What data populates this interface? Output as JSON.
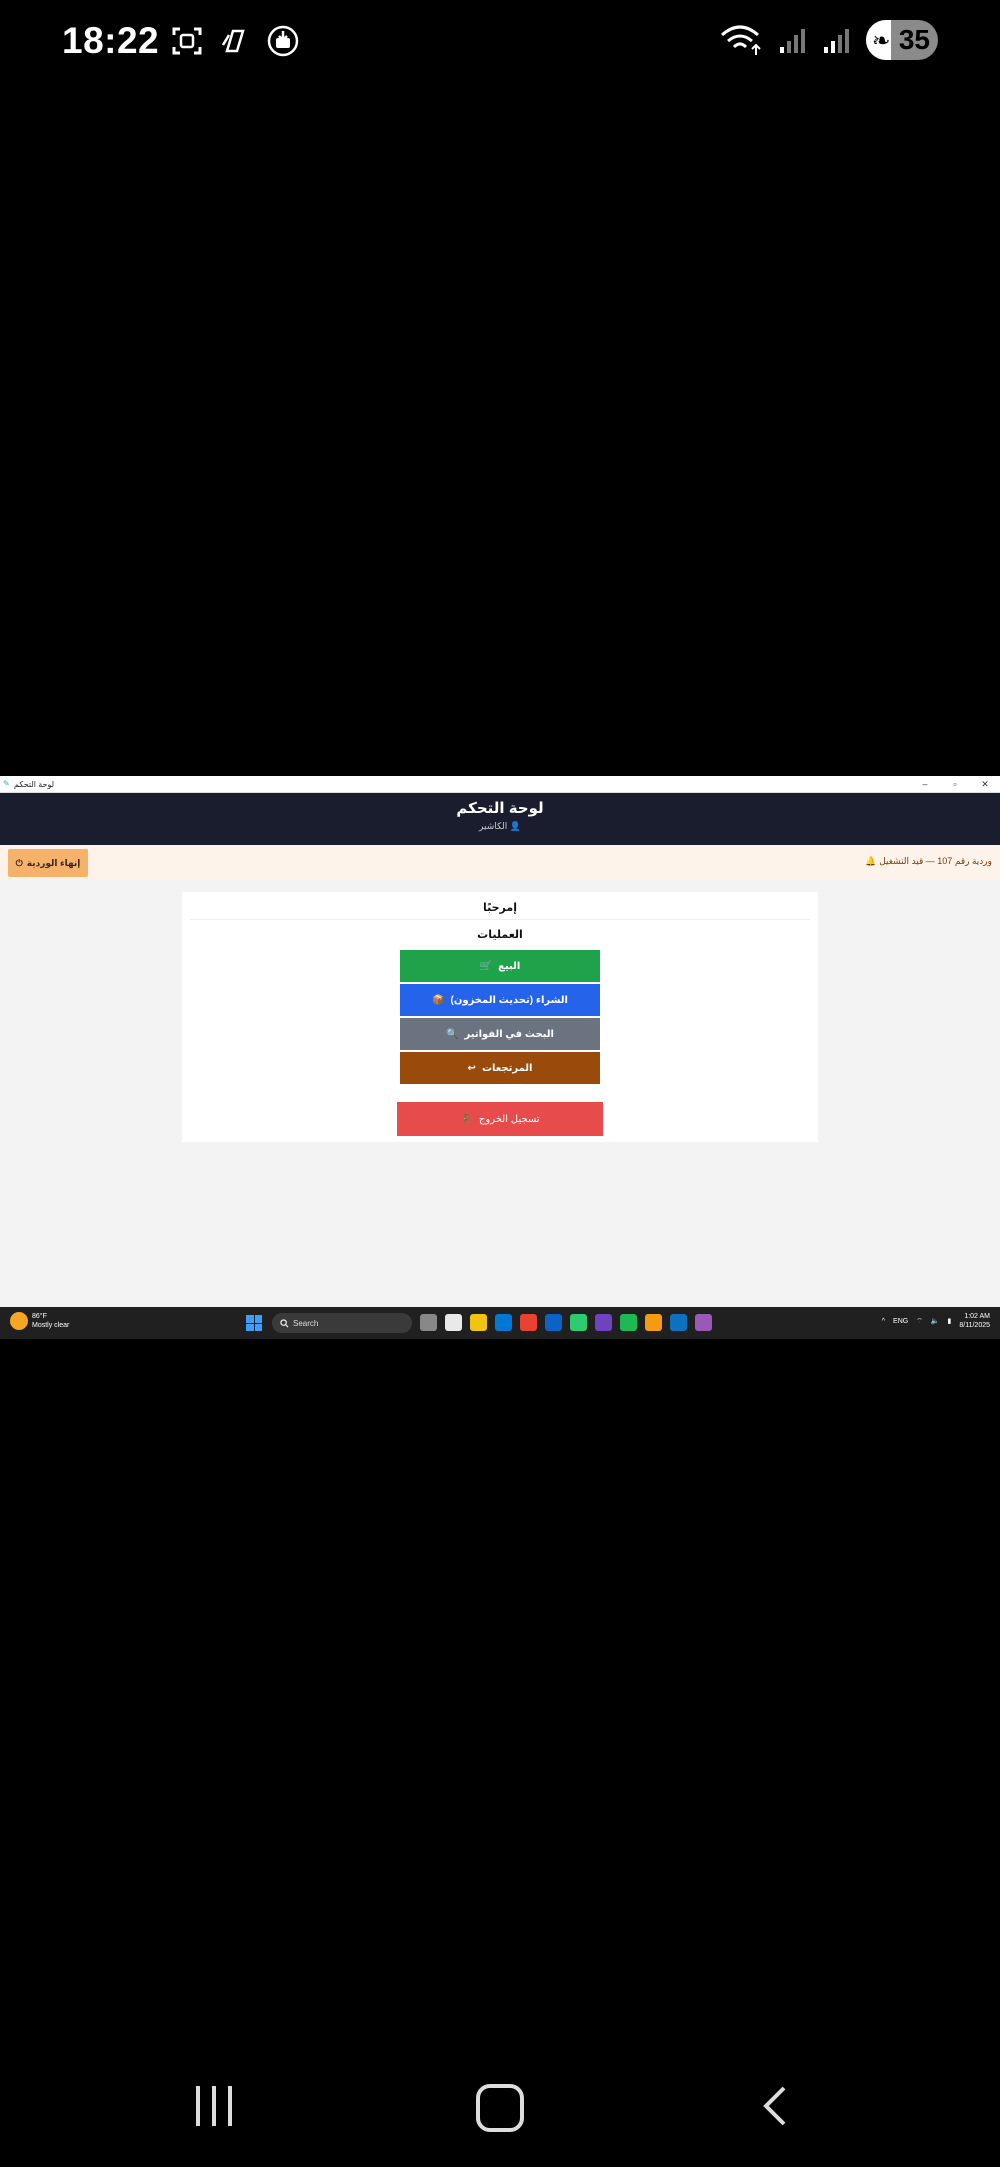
{
  "phone_status": {
    "time": "18:22",
    "battery": "35",
    "icons_left": [
      "screenshot-icon",
      "copilot-icon",
      "download-icon"
    ],
    "icons_right": [
      "wifi-icon",
      "signal-icon",
      "signal-icon-2"
    ]
  },
  "window": {
    "title": "لوحة التحكم",
    "controls": [
      "–",
      "▫",
      "✕"
    ]
  },
  "header": {
    "title": "لوحة التحكم",
    "user_icon": "👤",
    "user": "الكاشير"
  },
  "shift": {
    "info": "وردية رقم 107 — قيد التشغيل",
    "info_icon": "🔔",
    "end_button": "إنهاء الوردية",
    "end_icon": "⏻"
  },
  "card": {
    "welcome": "إمرحبًا",
    "operations_title": "العمليات",
    "buttons": [
      {
        "label": "البيع",
        "icon": "🛒",
        "color": "#1ea34a"
      },
      {
        "label": "الشراء (تحديث المخزون)",
        "icon": "📦",
        "color": "#2563eb"
      },
      {
        "label": "البحث في الفواتير",
        "icon": "🔍",
        "color": "#6b7280"
      },
      {
        "label": "المرتجعات",
        "icon": "↩",
        "color": "#9a4a0a"
      }
    ],
    "logout": "تسجيل الخروج",
    "logout_icon": "🚪"
  },
  "taskbar": {
    "weather_temp": "86°F",
    "weather_text": "Mostly clear",
    "search_placeholder": "Search",
    "lang": "ENG",
    "time": "1:02 AM",
    "date": "8/11/2025",
    "apps": [
      "#888888",
      "#e9e9e9",
      "#f1c40f",
      "#0078d4",
      "#e94235",
      "#0b63c5",
      "#2ecc71",
      "#6f42c1",
      "#1db954",
      "#f39c12",
      "#0e70c0",
      "#9b59b6"
    ]
  }
}
